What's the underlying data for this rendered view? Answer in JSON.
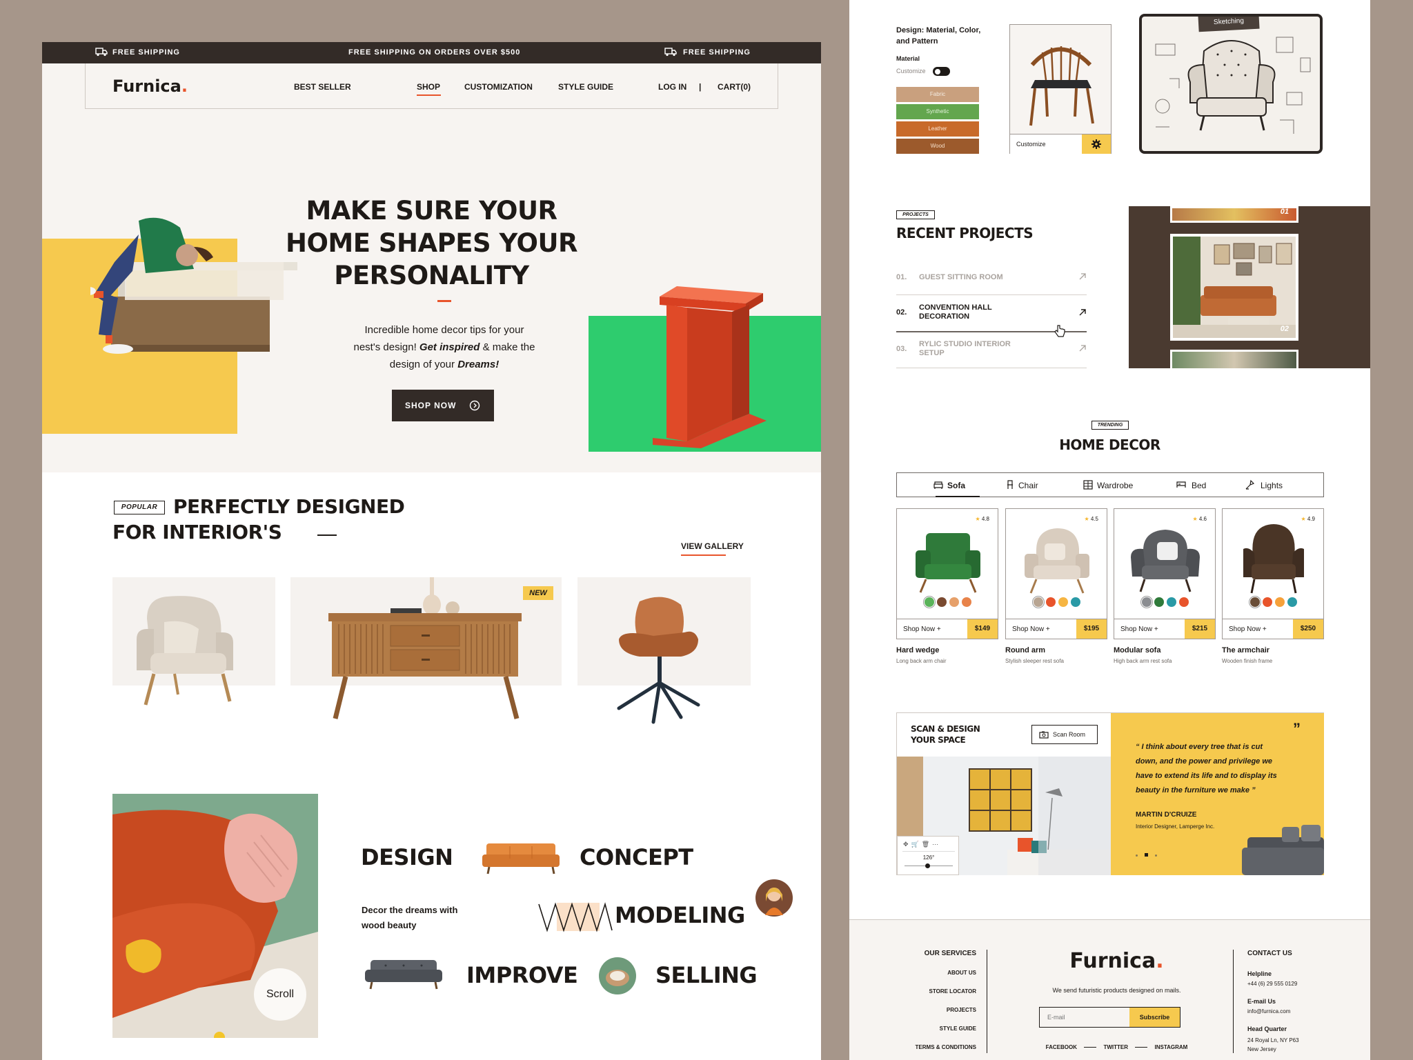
{
  "topbar": {
    "left": "FREE SHIPPING",
    "center": "FREE SHIPPING ON ORDERS OVER $500",
    "right": "FREE SHIPPING"
  },
  "nav": {
    "logo": "Furnica",
    "logo_dot": ".",
    "items": [
      "BEST SELLER",
      "SHOP",
      "CUSTOMIZATION",
      "STYLE GUIDE"
    ],
    "active_item": "SHOP",
    "login": "LOG IN",
    "separator": "|",
    "cart": "CART(0)"
  },
  "hero": {
    "title_line1": "MAKE SURE YOUR",
    "title_line2": "HOME SHAPES YOUR",
    "title_line3": "PERSONALITY",
    "desc_line1": "Incredible home decor tips for your",
    "desc_line2_a": "nest's design! ",
    "desc_line2_b": "Get inspired",
    "desc_line2_c": " & make the",
    "desc_line3_a": "design of your ",
    "desc_line3_b": "Dreams!",
    "cta": "SHOP NOW"
  },
  "popular": {
    "badge": "POPULAR",
    "title_line1": "PERFECTLY DESIGNED",
    "title_line2": "FOR INTERIOR'S",
    "view_gallery": "VIEW GALLERY",
    "new_badge": "NEW"
  },
  "concepts": {
    "words": [
      "DESIGN",
      "CONCEPT",
      "MODELING",
      "IMPROVE",
      "SELLING"
    ],
    "tagline_line1": "Decor the dreams with",
    "tagline_line2": "wood beauty",
    "scroll": "Scroll"
  },
  "customizer": {
    "title_line1": "Design: Material, Color,",
    "title_line2": "and Pattern",
    "material_label": "Material",
    "customize_toggle": "Customize",
    "swatches": [
      "Fabric",
      "Synthetic",
      "Leather",
      "Wood"
    ],
    "customize_button": "Customize",
    "sketch_label": "Sketching"
  },
  "projects": {
    "badge": "PROJECTS",
    "title": "RECENT PROJECTS",
    "items": [
      {
        "num": "01.",
        "name_line1": "GUEST SITTING ROOM",
        "name_line2": ""
      },
      {
        "num": "02.",
        "name_line1": "CONVENTION HALL",
        "name_line2": "DECORATION"
      },
      {
        "num": "03.",
        "name_line1": "RYLIC STUDIO INTERIOR",
        "name_line2": "SETUP"
      }
    ],
    "gallery_nums": [
      "01",
      "02"
    ]
  },
  "trending": {
    "badge": "TRENDING",
    "title": "HOME DECOR",
    "tabs": [
      "Sofa",
      "Chair",
      "Wardrobe",
      "Bed",
      "Lights"
    ],
    "products": [
      {
        "rating": "4.8",
        "shop": "Shop Now",
        "price": "$149",
        "name": "Hard wedge",
        "desc": "Long back arm chair"
      },
      {
        "rating": "4.5",
        "shop": "Shop Now",
        "price": "$195",
        "name": "Round arm",
        "desc": "Stylish sleeper rest sofa"
      },
      {
        "rating": "4.6",
        "shop": "Shop Now",
        "price": "$215",
        "name": "Modular sofa",
        "desc": "High back arm rest sofa"
      },
      {
        "rating": "4.9",
        "shop": "Shop Now",
        "price": "$250",
        "name": "The armchair",
        "desc": "Wooden finish frame"
      }
    ]
  },
  "scan": {
    "title_line1": "SCAN & DESIGN",
    "title_line2": "YOUR SPACE",
    "button": "Scan Room",
    "angle": "126°",
    "quote_line1": "“ I think about every tree that is cut",
    "quote_line2": "down, and the power and privilege we",
    "quote_line3": "have to extend its life and to display its",
    "quote_line4": "beauty in the furniture we make ”",
    "author": "MARTIN D'CRUIZE",
    "role": "Interior Designer, Lamperge Inc."
  },
  "footer": {
    "services_title": "OUR SERVICES",
    "services": [
      "ABOUT US",
      "STORE LOCATOR",
      "PROJECTS",
      "STYLE GUIDE",
      "TERMS & CONDITIONS"
    ],
    "logo": "Furnica",
    "logo_dot": ".",
    "tagline": "We send futuristic products designed on mails.",
    "email_placeholder": "E-mail",
    "subscribe": "Subscribe",
    "social": [
      "FACEBOOK",
      "TWITTER",
      "INSTAGRAM"
    ],
    "contact_title": "CONTACT US",
    "helpline_label": "Helpline",
    "helpline": "+44 (6) 29 555 0129",
    "email_label": "E-mail Us",
    "email": "info@furnica.com",
    "hq_label": "Head Quarter",
    "hq_line1": "24 Royal Ln, NY P63",
    "hq_line2": "New Jersey"
  },
  "colors": {
    "accent": "#e8542b",
    "dark": "#332b27",
    "yellow": "#f6c94e",
    "green": "#2ecc6e",
    "background": "#a6968a"
  }
}
